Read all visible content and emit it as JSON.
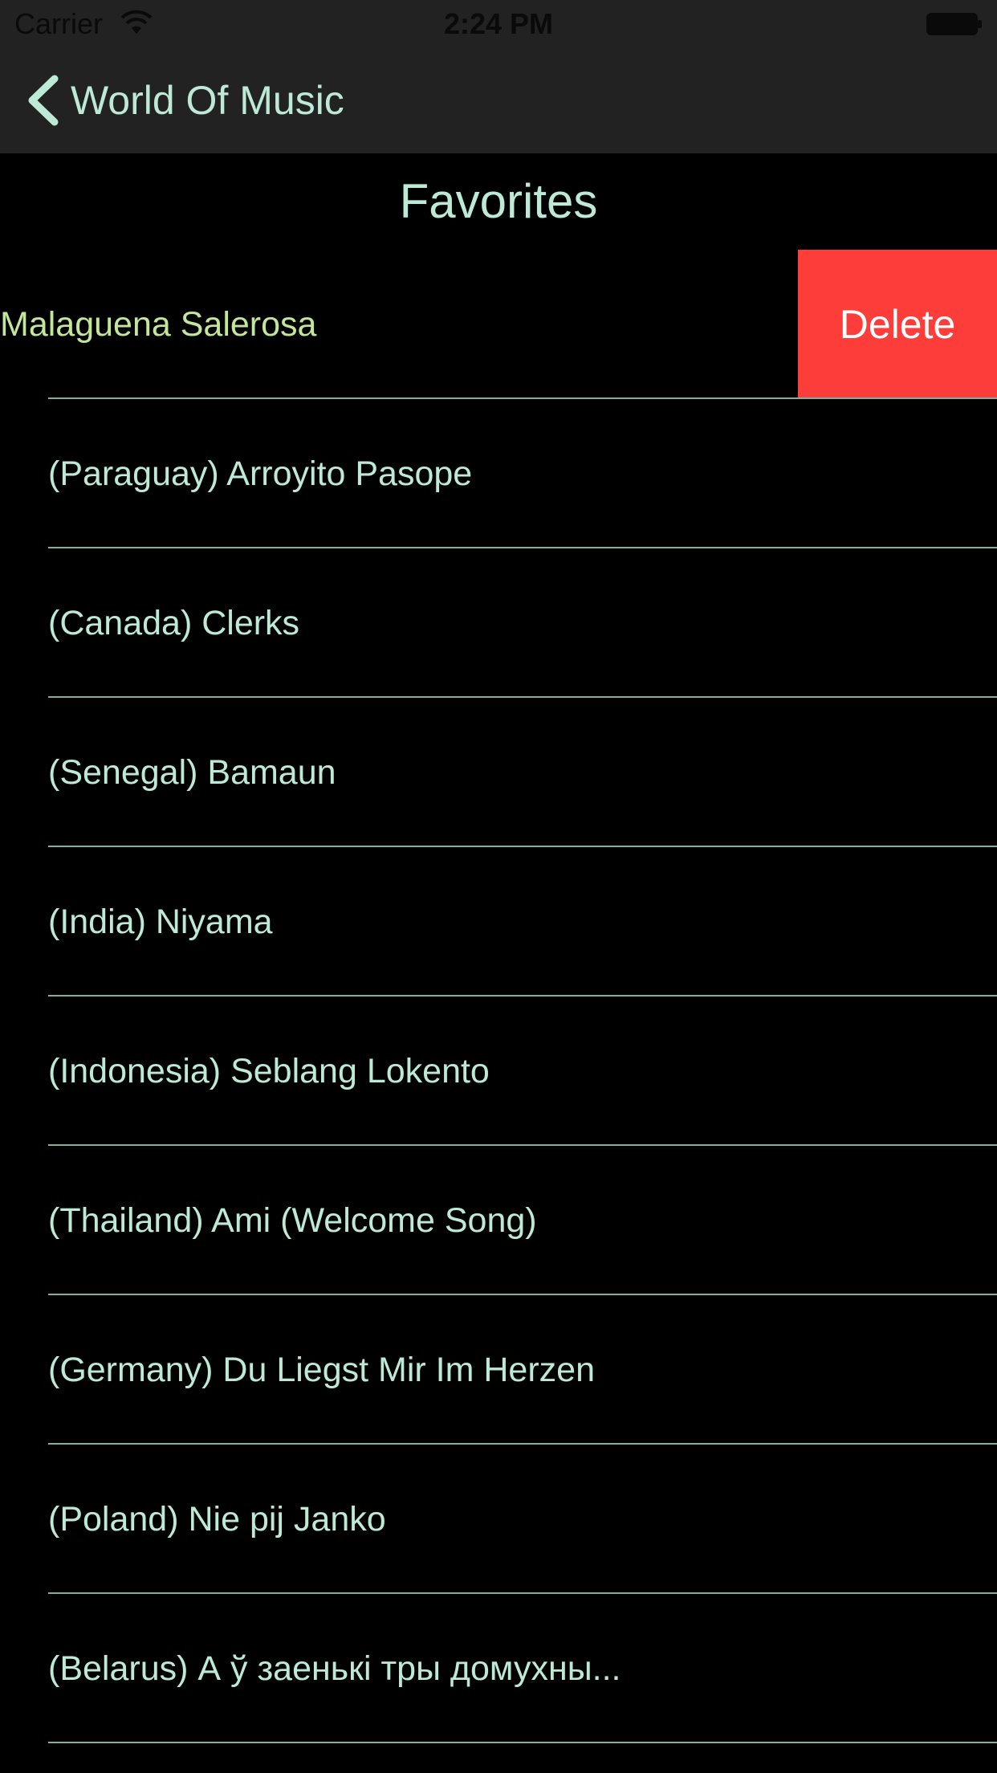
{
  "status_bar": {
    "carrier": "Carrier",
    "time": "2:24 PM"
  },
  "nav": {
    "back_label": "World Of Music"
  },
  "section": {
    "title": "Favorites"
  },
  "swiped_row": {
    "label": "Malaguena Salerosa",
    "delete_label": "Delete"
  },
  "rows": [
    {
      "label": "(Paraguay) Arroyito Pasope"
    },
    {
      "label": "(Canada) Clerks"
    },
    {
      "label": "(Senegal) Bamaun"
    },
    {
      "label": "(India) Niyama"
    },
    {
      "label": "(Indonesia) Seblang Lokento"
    },
    {
      "label": "(Thailand) Ami (Welcome Song)"
    },
    {
      "label": "(Germany) Du Liegst Mir Im Herzen"
    },
    {
      "label": "(Poland) Nie pij Janko"
    },
    {
      "label": "(Belarus) А ў заенькі тры домухны..."
    }
  ],
  "colors": {
    "accent": "#bde9d7",
    "swiped_text": "#c2e79a",
    "delete": "#fc3d39",
    "nav_background": "#222222",
    "background": "#000000"
  },
  "icons": {
    "back": "chevron-left-icon",
    "wifi": "wifi-icon",
    "battery": "battery-icon"
  }
}
